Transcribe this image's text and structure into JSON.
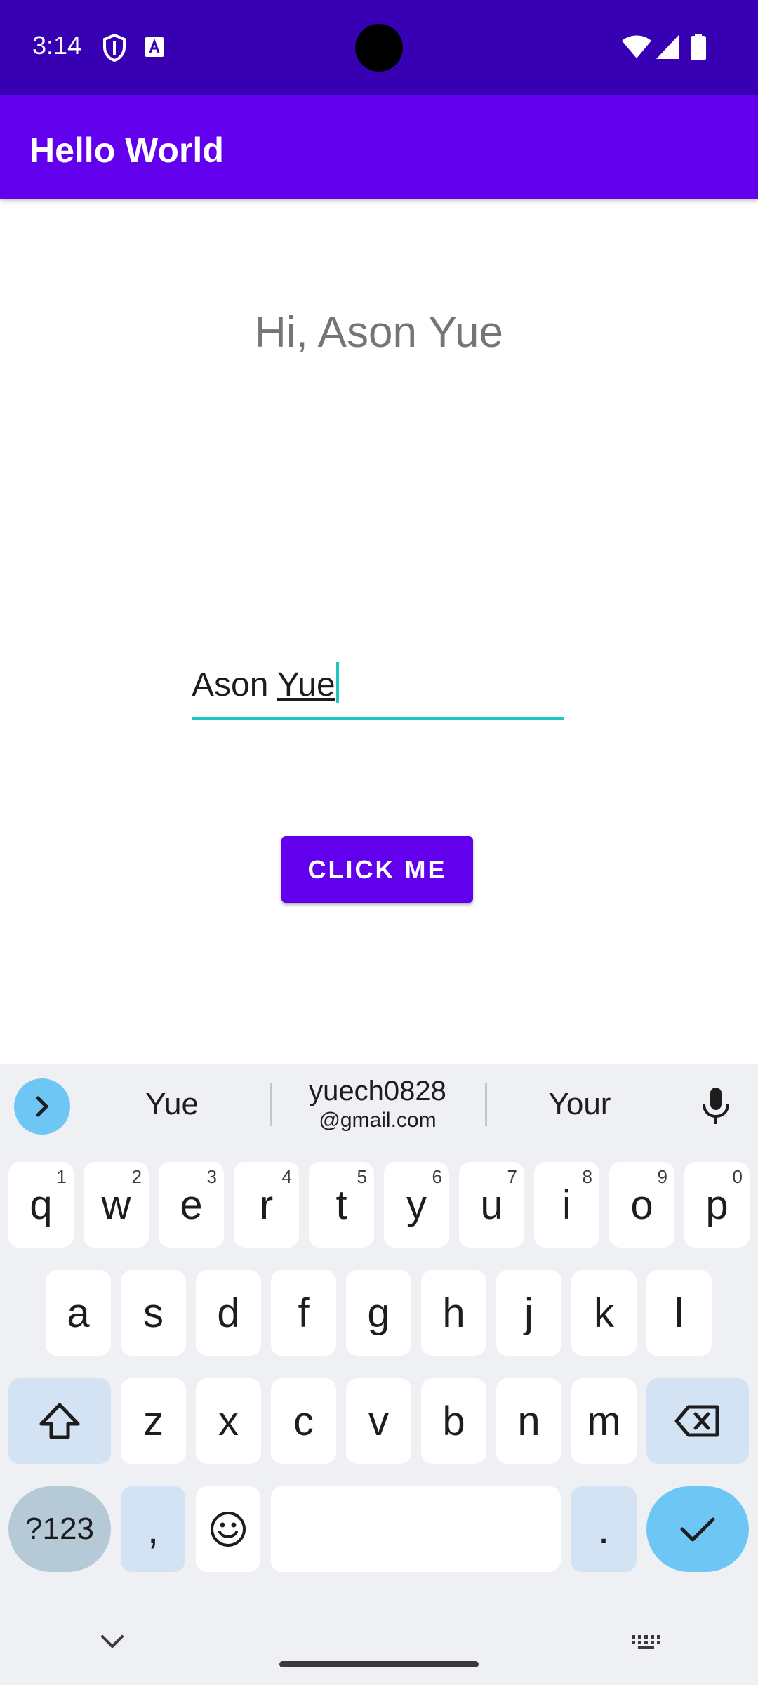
{
  "status_bar": {
    "time": "3:14"
  },
  "app_bar": {
    "title": "Hello World"
  },
  "main": {
    "greeting": "Hi, Ason Yue",
    "name_input": {
      "value_prefix": "Ason ",
      "value_composing": "Yue"
    },
    "button_label": "CLICK ME"
  },
  "keyboard": {
    "suggestions": [
      {
        "text": "Yue"
      },
      {
        "text": "yuech0828",
        "sub": "@gmail.com"
      },
      {
        "text": "Your"
      }
    ],
    "row1": [
      {
        "k": "q",
        "h": "1"
      },
      {
        "k": "w",
        "h": "2"
      },
      {
        "k": "e",
        "h": "3"
      },
      {
        "k": "r",
        "h": "4"
      },
      {
        "k": "t",
        "h": "5"
      },
      {
        "k": "y",
        "h": "6"
      },
      {
        "k": "u",
        "h": "7"
      },
      {
        "k": "i",
        "h": "8"
      },
      {
        "k": "o",
        "h": "9"
      },
      {
        "k": "p",
        "h": "0"
      }
    ],
    "row2": [
      "a",
      "s",
      "d",
      "f",
      "g",
      "h",
      "j",
      "k",
      "l"
    ],
    "row3": [
      "z",
      "x",
      "c",
      "v",
      "b",
      "n",
      "m"
    ],
    "symbols_label": "?123",
    "comma_label": ",",
    "period_label": "."
  },
  "colors": {
    "status_bar": "#3700b3",
    "app_bar": "#6200ee",
    "accent": "#1ec8bd",
    "keyboard_action": "#6ec6f4"
  }
}
